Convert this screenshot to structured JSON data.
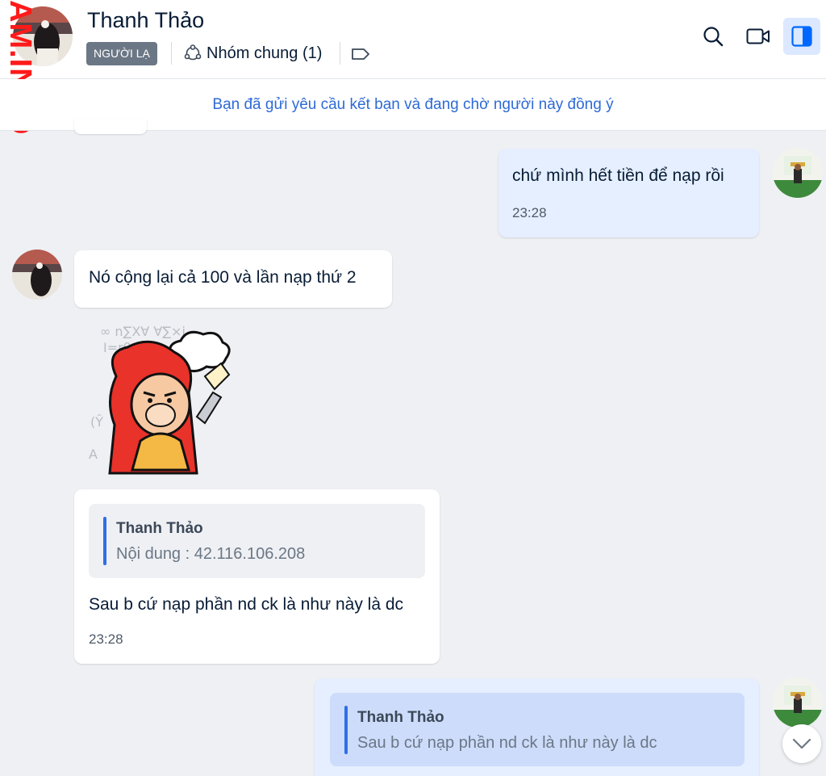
{
  "watermark": "AM.INFO",
  "header": {
    "contact_name": "Thanh Thảo",
    "stranger_tag": "NGƯỜI LẠ",
    "common_groups": "Nhóm chung (1)"
  },
  "banner": "Bạn đã gửi yêu cầu kết bạn và đang chờ người này đồng ý",
  "messages": [
    {
      "direction": "out",
      "text": "chứ mình hết tiền để nạp rồi",
      "time": "23:28"
    },
    {
      "direction": "in",
      "text": "Nó cộng lại cả 100 và lần nạp thứ 2"
    },
    {
      "direction": "in",
      "type": "sticker",
      "sticker": "thinking-monkey-sticker"
    },
    {
      "direction": "in",
      "quote": {
        "name": "Thanh Thảo",
        "text": "Nội dung : 42.116.106.208"
      },
      "text": "Sau b cứ nạp phần nd ck là như này là dc",
      "time": "23:28"
    },
    {
      "direction": "out",
      "quote": {
        "name": "Thanh Thảo",
        "text": "Sau b cứ nạp phần nd ck là như này là dc"
      }
    }
  ],
  "colors": {
    "accent": "#2e6ad6",
    "bubble_out": "#e5efff",
    "bubble_in": "#ffffff",
    "background": "#eef0f4",
    "watermark": "#ff1a1a"
  }
}
